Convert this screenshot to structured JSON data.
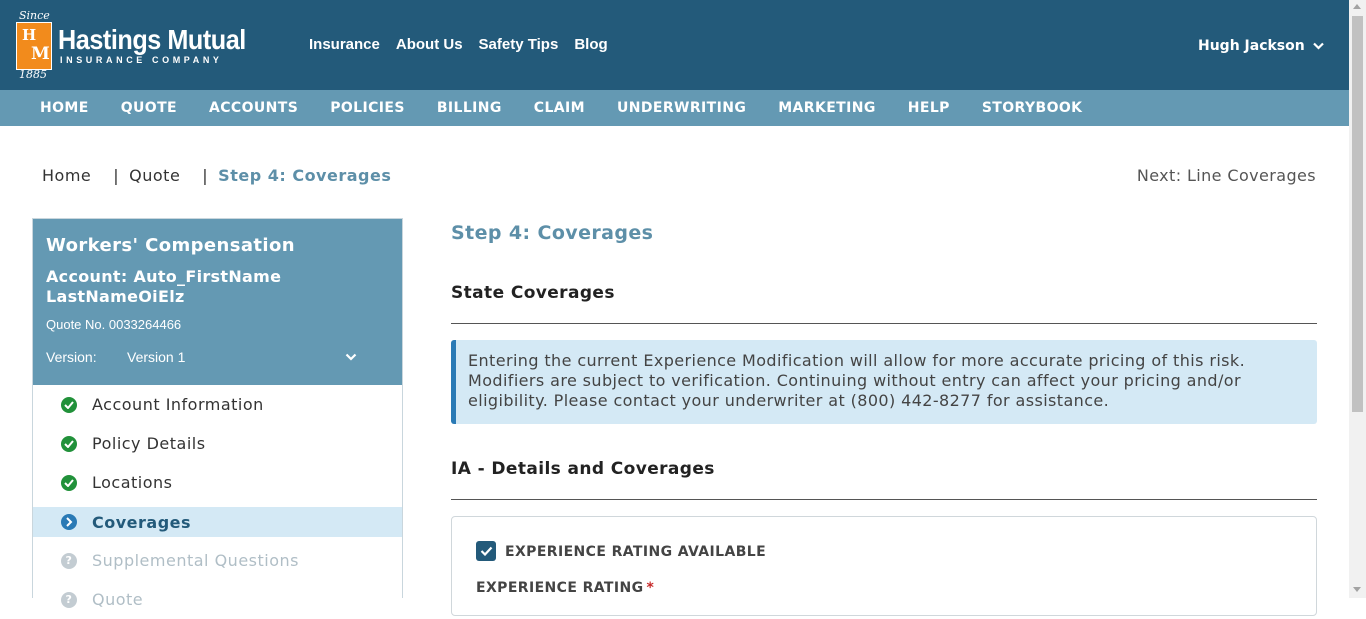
{
  "brand": {
    "since": "Since",
    "logo_letters": "HM",
    "name": "Hastings Mutual",
    "subtitle": "INSURANCE COMPANY",
    "year": "1885"
  },
  "top_nav": [
    "Insurance",
    "About Us",
    "Safety Tips",
    "Blog"
  ],
  "user": {
    "name": "Hugh Jackson",
    "icon": "chevron-down-icon"
  },
  "main_nav": [
    "HOME",
    "QUOTE",
    "ACCOUNTS",
    "POLICIES",
    "BILLING",
    "CLAIM",
    "UNDERWRITING",
    "MARKETING",
    "HELP",
    "STORYBOOK"
  ],
  "breadcrumb": {
    "items": [
      "Home",
      "Quote"
    ],
    "separator": "|",
    "current": "Step 4: Coverages"
  },
  "next_link": "Next: Line Coverages",
  "sidebar": {
    "title": "Workers' Compensation",
    "account": "Account: Auto_FirstName LastNameOiElz",
    "quote_no": "Quote No. 0033264466",
    "version_label": "Version:",
    "version_value": "Version 1",
    "steps": [
      {
        "label": "Account Information",
        "status": "done",
        "icon": "check-circle-icon"
      },
      {
        "label": "Policy Details",
        "status": "done",
        "icon": "check-circle-icon"
      },
      {
        "label": "Locations",
        "status": "done",
        "icon": "check-circle-icon"
      },
      {
        "label": "Coverages",
        "status": "active",
        "icon": "chevron-right-circle-icon"
      },
      {
        "label": "Supplemental Questions",
        "status": "todo",
        "icon": "question-circle-icon"
      },
      {
        "label": "Quote",
        "status": "todo",
        "icon": "question-circle-icon"
      }
    ]
  },
  "main": {
    "title": "Step 4: Coverages",
    "state_coverages": "State Coverages",
    "alert": "Entering the current Experience Modification will allow for more accurate pricing of this risk. Modifiers are subject to verification. Continuing without entry can affect your pricing and/or eligibility. Please contact your underwriter at (800) 442-8277 for assistance.",
    "ia_section": "IA - Details and Coverages",
    "experience_rating_available": {
      "label": "EXPERIENCE RATING AVAILABLE",
      "checked": true
    },
    "experience_rating_label": "EXPERIENCE RATING",
    "required_marker": "*"
  },
  "colors": {
    "header_bg": "#235a7a",
    "nav_bg": "#6499b3",
    "accent": "#5d8fa8",
    "done": "#21913a",
    "active": "#2a7ab5",
    "alert_bg": "#d4e9f5",
    "logo_orange": "#f28b1c"
  }
}
